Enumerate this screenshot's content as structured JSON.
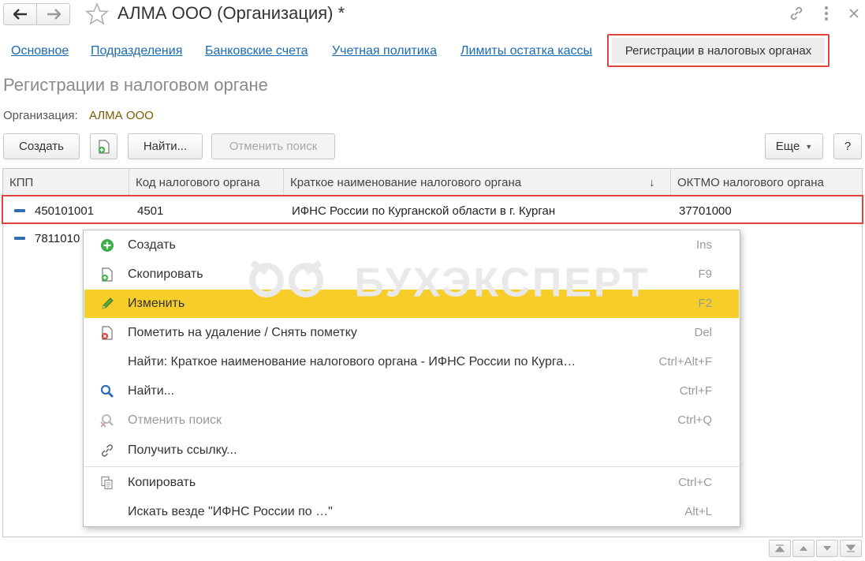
{
  "window": {
    "title": "АЛМА ООО (Организация) *"
  },
  "tabs": [
    {
      "label": "Основное"
    },
    {
      "label": "Подразделения"
    },
    {
      "label": "Банковские счета"
    },
    {
      "label": "Учетная политика"
    },
    {
      "label": "Лимиты остатка кассы"
    },
    {
      "label": "Регистрации в налоговых органах"
    }
  ],
  "section_title": "Регистрации в налоговом органе",
  "organization": {
    "label": "Организация:",
    "value": "АЛМА ООО"
  },
  "toolbar": {
    "create_label": "Создать",
    "find_label": "Найти...",
    "cancel_search_label": "Отменить поиск",
    "more_label": "Еще",
    "help_label": "?"
  },
  "table": {
    "columns": [
      "КПП",
      "Код налогового органа",
      "Краткое наименование налогового органа",
      "ОКТМО налогового органа"
    ],
    "sort_indicator": "↓",
    "rows": [
      {
        "kpp": "450101001",
        "code": "4501",
        "name": "ИФНС России по Курганской области в г. Курган",
        "oktmo": "37701000"
      },
      {
        "kpp": "7811010",
        "code": "",
        "name": "",
        "oktmo": ""
      }
    ]
  },
  "context_menu": {
    "items": [
      {
        "label": "Создать",
        "shortcut": "Ins",
        "icon": "plus-circle-icon"
      },
      {
        "label": "Скопировать",
        "shortcut": "F9",
        "icon": "copy-doc-icon"
      },
      {
        "label": "Изменить",
        "shortcut": "F2",
        "icon": "pencil-icon",
        "selected": true
      },
      {
        "label": "Пометить на удаление / Снять пометку",
        "shortcut": "Del",
        "icon": "delete-mark-icon"
      },
      {
        "label": "Найти: Краткое наименование налогового органа - ИФНС России по Курга…",
        "shortcut": "Ctrl+Alt+F",
        "icon": ""
      },
      {
        "label": "Найти...",
        "shortcut": "Ctrl+F",
        "icon": "search-icon"
      },
      {
        "label": "Отменить поиск",
        "shortcut": "Ctrl+Q",
        "icon": "cancel-search-icon",
        "disabled": true
      },
      {
        "label": "Получить ссылку...",
        "shortcut": "",
        "icon": "link-icon"
      },
      {
        "label": "Копировать",
        "shortcut": "Ctrl+C",
        "icon": "clipboard-icon"
      },
      {
        "label": "Искать везде \"ИФНС России по …\"",
        "shortcut": "Alt+L",
        "icon": ""
      }
    ]
  },
  "watermark": "БУХЭКСПЕРТ",
  "colors": {
    "link": "#1b6ab5",
    "highlight_border": "#e0453b",
    "menu_selection": "#f7cd2a",
    "org_value": "#7a5b00"
  }
}
